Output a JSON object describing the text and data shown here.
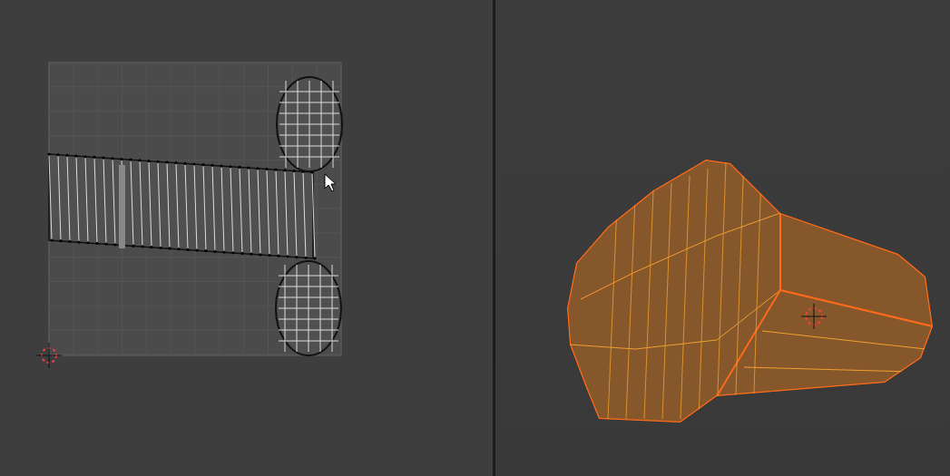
{
  "uv_editor": {
    "islands": [
      {
        "kind": "strip"
      },
      {
        "kind": "ellipse"
      },
      {
        "kind": "ellipse"
      }
    ]
  },
  "viewport": {
    "mesh": {
      "selected": true
    }
  }
}
